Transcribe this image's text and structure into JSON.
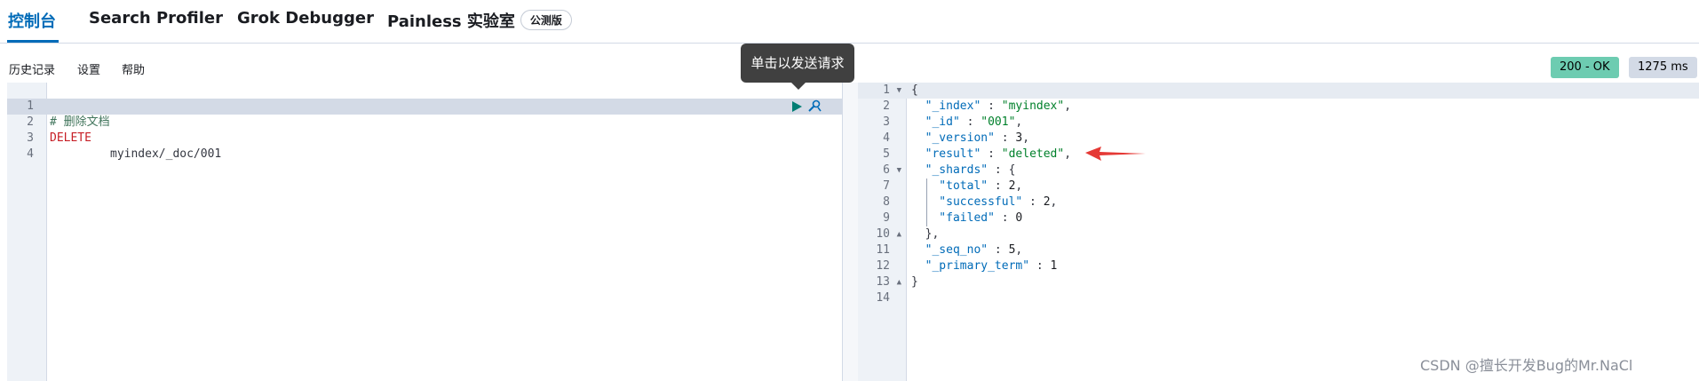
{
  "tabs": [
    {
      "label": "控制台",
      "active": true
    },
    {
      "label": "Search Profiler"
    },
    {
      "label": "Grok Debugger"
    },
    {
      "label": "Painless 实验室",
      "badge": "公测版"
    }
  ],
  "toolbar": {
    "history": "历史记录",
    "settings": "设置",
    "help": "帮助"
  },
  "status": {
    "code": "200 - OK",
    "time": "1275 ms"
  },
  "tooltip": "单击以发送请求",
  "request": {
    "line_numbers": [
      "1",
      "2",
      "3",
      "4"
    ],
    "comment": "# 删除文档",
    "method": "DELETE",
    "path": "myindex/_doc/001"
  },
  "response": {
    "line_numbers": [
      "1",
      "2",
      "3",
      "4",
      "5",
      "6",
      "7",
      "8",
      "9",
      "10",
      "11",
      "12",
      "13",
      "14"
    ],
    "lines": [
      {
        "parts": [
          [
            "punc",
            "{"
          ]
        ]
      },
      {
        "parts": [
          [
            "key",
            "  \"_index\""
          ],
          [
            "punc",
            " : "
          ],
          [
            "str",
            "\"myindex\""
          ],
          [
            "punc",
            ","
          ]
        ]
      },
      {
        "parts": [
          [
            "key",
            "  \"_id\""
          ],
          [
            "punc",
            " : "
          ],
          [
            "str",
            "\"001\""
          ],
          [
            "punc",
            ","
          ]
        ]
      },
      {
        "parts": [
          [
            "key",
            "  \"_version\""
          ],
          [
            "punc",
            " : "
          ],
          [
            "num",
            "3"
          ],
          [
            "punc",
            ","
          ]
        ]
      },
      {
        "parts": [
          [
            "key",
            "  \"result\""
          ],
          [
            "punc",
            " : "
          ],
          [
            "str",
            "\"deleted\""
          ],
          [
            "punc",
            ","
          ]
        ]
      },
      {
        "parts": [
          [
            "key",
            "  \"_shards\""
          ],
          [
            "punc",
            " : {"
          ]
        ]
      },
      {
        "parts": [
          [
            "key",
            "    \"total\""
          ],
          [
            "punc",
            " : "
          ],
          [
            "num",
            "2"
          ],
          [
            "punc",
            ","
          ]
        ]
      },
      {
        "parts": [
          [
            "key",
            "    \"successful\""
          ],
          [
            "punc",
            " : "
          ],
          [
            "num",
            "2"
          ],
          [
            "punc",
            ","
          ]
        ]
      },
      {
        "parts": [
          [
            "key",
            "    \"failed\""
          ],
          [
            "punc",
            " : "
          ],
          [
            "num",
            "0"
          ]
        ]
      },
      {
        "parts": [
          [
            "punc",
            "  },"
          ]
        ]
      },
      {
        "parts": [
          [
            "key",
            "  \"_seq_no\""
          ],
          [
            "punc",
            " : "
          ],
          [
            "num",
            "5"
          ],
          [
            "punc",
            ","
          ]
        ]
      },
      {
        "parts": [
          [
            "key",
            "  \"_primary_term\""
          ],
          [
            "punc",
            " : "
          ],
          [
            "num",
            "1"
          ]
        ]
      },
      {
        "parts": [
          [
            "punc",
            "}"
          ]
        ]
      },
      {
        "parts": []
      }
    ]
  },
  "watermark": "CSDN @擅长开发Bug的Mr.NaCl",
  "colors": {
    "accent": "#006bb8",
    "status_ok": "#6dccb1",
    "arrow": "#e53935"
  }
}
